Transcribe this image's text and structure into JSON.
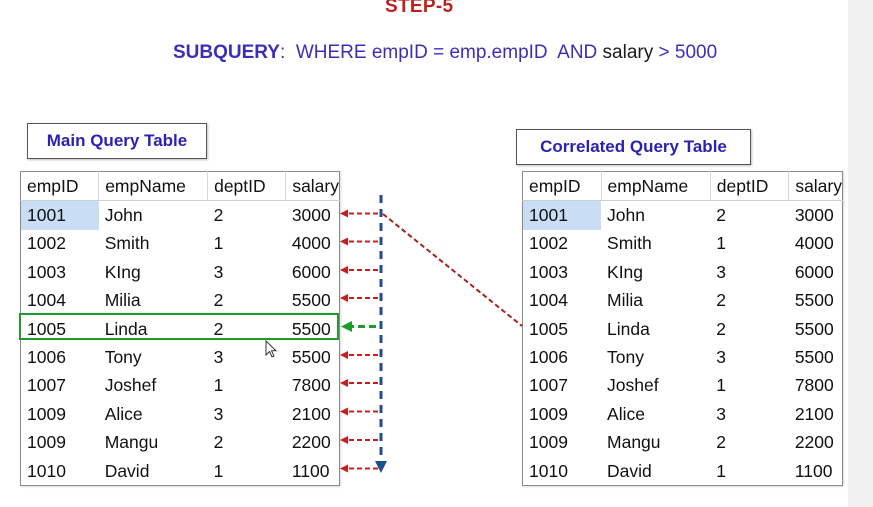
{
  "step_title": "STEP-5",
  "subquery": {
    "keyword": "SUBQUERY",
    "condition_part1": "WHERE empID = emp.empID  AND ",
    "condition_part2": "salary",
    "condition_part3": " > 5000"
  },
  "main_table": {
    "caption": "Main Query Table",
    "columns": [
      "empID",
      "empName",
      "deptID",
      "salary"
    ],
    "rows": [
      [
        "1001",
        "John",
        "2",
        "3000"
      ],
      [
        "1002",
        "Smith",
        "1",
        "4000"
      ],
      [
        "1003",
        "KIng",
        "3",
        "6000"
      ],
      [
        "1004",
        "Milia",
        "2",
        "5500"
      ],
      [
        "1005",
        "Linda",
        "2",
        "5500"
      ],
      [
        "1006",
        "Tony",
        "3",
        "5500"
      ],
      [
        "1007",
        "Joshef",
        "1",
        "7800"
      ],
      [
        "1009",
        "Alice",
        "3",
        "2100"
      ],
      [
        "1009",
        "Mangu",
        "2",
        "2200"
      ],
      [
        "1010",
        "David",
        "1",
        "1100"
      ]
    ],
    "selected_cell": "1001",
    "highlighted_row": "1005"
  },
  "correlated_table": {
    "caption": "Correlated Query Table",
    "columns": [
      "empID",
      "empName",
      "deptID",
      "salary"
    ],
    "rows": [
      [
        "1001",
        "John",
        "2",
        "3000"
      ],
      [
        "1002",
        "Smith",
        "1",
        "4000"
      ],
      [
        "1003",
        "KIng",
        "3",
        "6000"
      ],
      [
        "1004",
        "Milia",
        "2",
        "5500"
      ],
      [
        "1005",
        "Linda",
        "2",
        "5500"
      ],
      [
        "1006",
        "Tony",
        "3",
        "5500"
      ],
      [
        "1007",
        "Joshef",
        "1",
        "7800"
      ],
      [
        "1009",
        "Alice",
        "3",
        "2100"
      ],
      [
        "1009",
        "Mangu",
        "2",
        "2200"
      ],
      [
        "1010",
        "David",
        "1",
        "1100"
      ]
    ],
    "selected_cell": "1001"
  },
  "colors": {
    "title_red": "#c0201b",
    "subquery_blue": "#3b2fb8",
    "caption_blue": "#2c22b0",
    "arrow_red": "#c42020",
    "arrow_green": "#1f9a2c",
    "scan_arrow_blue": "#1f4f8f",
    "selection_blue": "#c9def5"
  },
  "icons": {
    "scan_arrow": "dashed-down-arrow-icon",
    "row_arrows": "dashed-left-arrow-icon",
    "link_line": "dashed-connector-icon",
    "cursor": "mouse-pointer-icon"
  }
}
